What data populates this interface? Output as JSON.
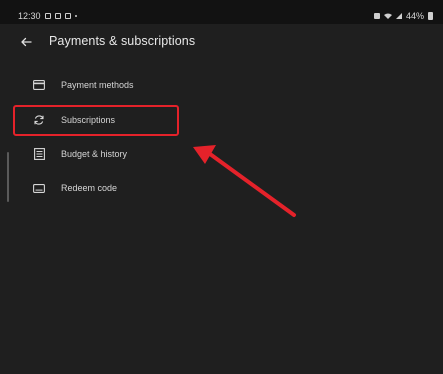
{
  "status_bar": {
    "time": "12:30",
    "battery": "44%"
  },
  "header": {
    "title": "Payments & subscriptions"
  },
  "menu": {
    "items": [
      {
        "label": "Payment methods",
        "icon": "credit-card-icon"
      },
      {
        "label": "Subscriptions",
        "icon": "refresh-icon"
      },
      {
        "label": "Budget & history",
        "icon": "receipt-icon"
      },
      {
        "label": "Redeem code",
        "icon": "keyboard-icon"
      }
    ]
  },
  "colors": {
    "annotation": "#e4222a",
    "background": "#1f1f1f"
  }
}
